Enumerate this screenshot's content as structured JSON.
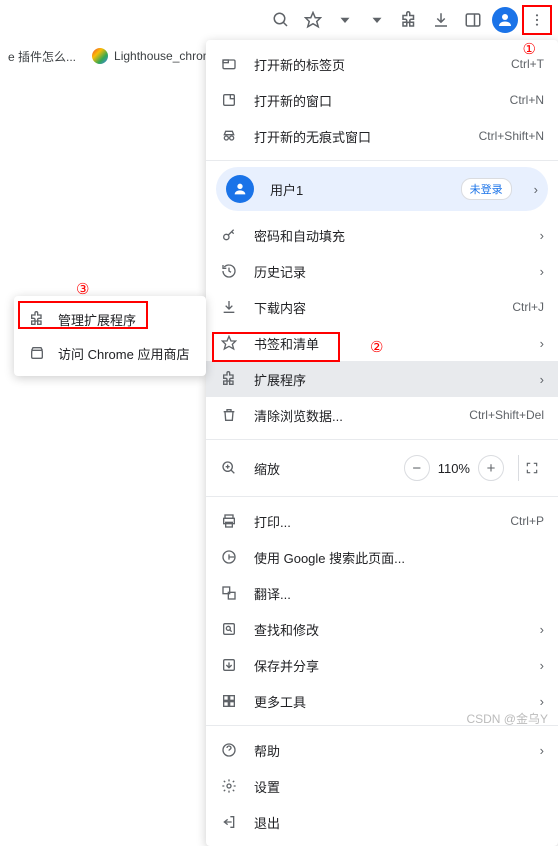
{
  "bookmarks": {
    "item0": "e 插件怎么...",
    "item1": "Lighthouse_chrom"
  },
  "menu": {
    "newTab": "打开新的标签页",
    "newTab_sc": "Ctrl+T",
    "newWin": "打开新的窗口",
    "newWin_sc": "Ctrl+N",
    "incognito": "打开新的无痕式窗口",
    "incognito_sc": "Ctrl+Shift+N",
    "user": "用户1",
    "notLoggedIn": "未登录",
    "passwords": "密码和自动填充",
    "history": "历史记录",
    "downloads": "下载内容",
    "downloads_sc": "Ctrl+J",
    "bookmarks": "书签和清单",
    "extensions": "扩展程序",
    "clearData": "清除浏览数据...",
    "clearData_sc": "Ctrl+Shift+Del",
    "zoom": "缩放",
    "zoomPct": "110%",
    "print": "打印...",
    "print_sc": "Ctrl+P",
    "searchPage": "使用 Google 搜索此页面...",
    "translate": "翻译...",
    "findEdit": "查找和修改",
    "saveShare": "保存并分享",
    "moreTools": "更多工具",
    "help": "帮助",
    "settings": "设置",
    "exit": "退出"
  },
  "submenu": {
    "manage": "管理扩展程序",
    "store": "访问 Chrome 应用商店"
  },
  "annotations": {
    "a1": "①",
    "a2": "②",
    "a3": "③"
  },
  "watermark": "CSDN @金乌Y"
}
